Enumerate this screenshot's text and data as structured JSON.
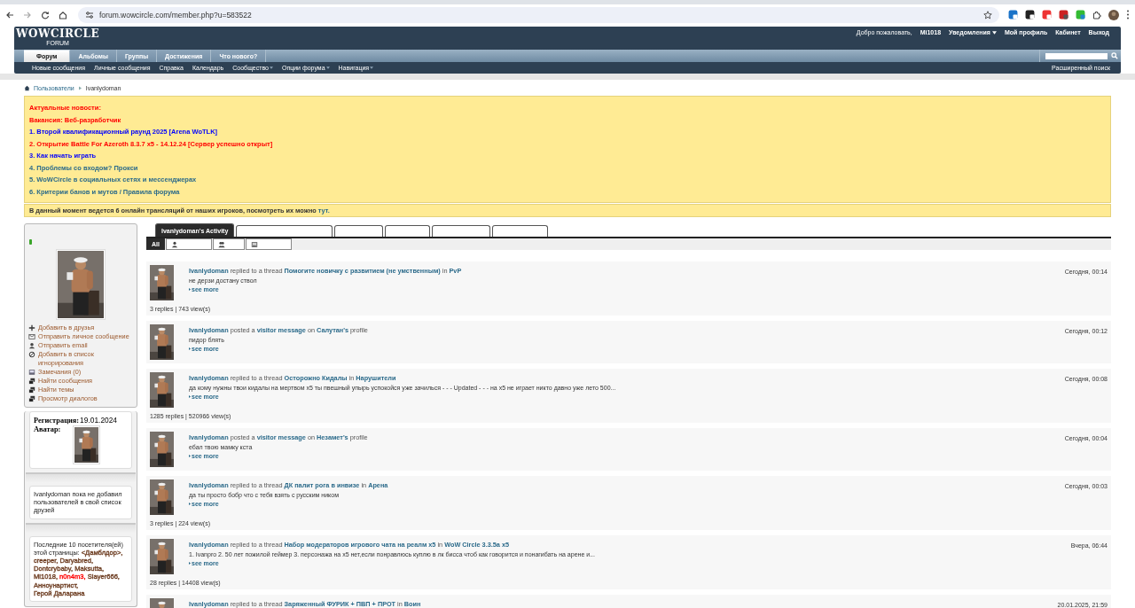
{
  "browser": {
    "url": "forum.wowcircle.com/member.php?u=583522"
  },
  "header": {
    "logo": "WOWCIRCLE",
    "logo_sub": "FORUM",
    "user_links": [
      {
        "label": "Добро пожаловать,",
        "kind": "text"
      },
      {
        "label": "Mi1018",
        "kind": "user"
      },
      {
        "label": "Уведомления",
        "kind": "menu"
      },
      {
        "label": "Мой профиль",
        "kind": "link"
      },
      {
        "label": "Кабинет",
        "kind": "link"
      },
      {
        "label": "Выход",
        "kind": "link"
      }
    ],
    "nav_tabs": [
      {
        "label": "Форум",
        "selected": true
      },
      {
        "label": "Альбомы",
        "selected": false
      },
      {
        "label": "Группы",
        "selected": false
      },
      {
        "label": "Достижения",
        "selected": false
      },
      {
        "label": "Что нового?",
        "selected": false
      }
    ],
    "subnav": [
      {
        "label": "Новые сообщения",
        "dropdown": false
      },
      {
        "label": "Личные сообщения",
        "dropdown": false
      },
      {
        "label": "Справка",
        "dropdown": false
      },
      {
        "label": "Календарь",
        "dropdown": false
      },
      {
        "label": "Сообщество",
        "dropdown": true
      },
      {
        "label": "Опции форума",
        "dropdown": true
      },
      {
        "label": "Навигация",
        "dropdown": true
      }
    ],
    "advanced_search": "Расширенный поиск"
  },
  "breadcrumb": [
    "Пользователи",
    "Ivanlydoman"
  ],
  "news": {
    "items": [
      {
        "text": "Актуальные новости:",
        "color": "#ff0000"
      },
      {
        "text": "Вакансия: Веб-разработчик",
        "color": "#ff0000"
      },
      {
        "text": "1. Второй квалификационный раунд 2025 [Arena WoTLK]",
        "color": "#0000ff"
      },
      {
        "text": "2. Открытие Battle For Azeroth 8.3.7 x5 - 14.12.24 [Сервер успешно открыт]",
        "color": "#ff0000"
      },
      {
        "text": "3. Как начать играть",
        "color": "#0000ff"
      },
      {
        "text": "4. Проблемы со входом? Прокси",
        "color": "#2b6a8a"
      },
      {
        "text": "5. WoWCircle в социальных сетях и мессенджерах",
        "color": "#2b6a8a"
      },
      {
        "text": "6. Критерии банов и мутов / Правила форума",
        "color": "#2b6a8a"
      }
    ]
  },
  "live_bar": {
    "text": "В данный момент ведется 6 онлайн трансляций от наших игроков, посмотреть их можно",
    "link": "тут."
  },
  "sidebar": {
    "online": true,
    "links": [
      "Добавить в друзья",
      "Отправить личное сообщение",
      "Отправить email",
      "Добавить в список игнорирования",
      "Замечания (0)",
      "Найти сообщения",
      "Найти темы",
      "Просмотр диалогов"
    ],
    "registration": {
      "label": "Регистрация:",
      "value": "19.01.2024"
    },
    "avatar_label": "Аватар:",
    "friends_text": "Ivanlydoman пока не добавил пользователей в свой список друзей",
    "visitors_intro": "Последние 10 посетителя(ей) этой страницы:",
    "visitors": [
      {
        "name": "<Дамблдор>,",
        "color": "#6b3a1e"
      },
      {
        "name": "creeper,",
        "color": "#6b3a1e"
      },
      {
        "name": "Daryabred,",
        "color": "#6b3a1e"
      },
      {
        "name": "Dontcrybaby,",
        "color": "#6b3a1e"
      },
      {
        "name": "Maksutta,",
        "color": "#6b3a1e"
      },
      {
        "name": "Mi1018,",
        "color": "#6b3a1e"
      },
      {
        "name": "n0n4m3,",
        "color": "#ff0000"
      },
      {
        "name": "Slayer666,",
        "color": "#6b3a1e"
      },
      {
        "name": "Анноунартист,",
        "color": "#6b3a1e"
      },
      {
        "name": "Герой Даларана",
        "color": "#6b3a1e"
      }
    ]
  },
  "activity": {
    "tabs": [
      {
        "label": "Ivanlydoman's Activity",
        "selected": true
      },
      {
        "selected": false
      },
      {
        "selected": false
      },
      {
        "selected": false
      },
      {
        "selected": false
      },
      {
        "selected": false
      }
    ],
    "subtabs": [
      {
        "label": "All",
        "selected": true
      },
      {
        "selected": false
      },
      {
        "selected": false
      },
      {
        "selected": false
      }
    ],
    "items": [
      {
        "headline": [
          {
            "text": "Ivanlydoman",
            "link": true
          },
          {
            "text": "replied to a thread",
            "link": false
          },
          {
            "text": "Помогите новичку с развитием (не умственным)",
            "link": true
          },
          {
            "text": "in",
            "link": false
          },
          {
            "text": "PvP",
            "link": true
          }
        ],
        "excerpt": "не дерзи достану ствол",
        "more": "see more",
        "stats": "3 replies | 743 view(s)",
        "time": "Сегодня, 00:14"
      },
      {
        "headline": [
          {
            "text": "Ivanlydoman",
            "link": true
          },
          {
            "text": "posted a",
            "link": false
          },
          {
            "text": "visitor message",
            "link": true
          },
          {
            "text": "on",
            "link": false
          },
          {
            "text": "Салутан's",
            "link": true
          },
          {
            "text": "profile",
            "link": false
          }
        ],
        "excerpt": "пидор блять",
        "more": "see more",
        "time": "Сегодня, 00:12"
      },
      {
        "headline": [
          {
            "text": "Ivanlydoman",
            "link": true
          },
          {
            "text": "replied to a thread",
            "link": false
          },
          {
            "text": "Осторожно Кидалы",
            "link": true
          },
          {
            "text": "in",
            "link": false
          },
          {
            "text": "Нарушители",
            "link": true
          }
        ],
        "excerpt": "да кому нужны твои кидалы на мертвом х5 ты пвешный упырь успокойся уже зачилься - - - Updated - - - на х5 не играет никто давно уже лето 500...",
        "more": "see more",
        "stats": "1285 replies | 520966 view(s)",
        "time": "Сегодня, 00:08"
      },
      {
        "headline": [
          {
            "text": "Ivanlydoman",
            "link": true
          },
          {
            "text": "posted a",
            "link": false
          },
          {
            "text": "visitor message",
            "link": true
          },
          {
            "text": "on",
            "link": false
          },
          {
            "text": "Незамет's",
            "link": true
          },
          {
            "text": "profile",
            "link": false
          }
        ],
        "excerpt": "ебал твою мамку кста",
        "more": "see more",
        "time": "Сегодня, 00:04"
      },
      {
        "headline": [
          {
            "text": "Ivanlydoman",
            "link": true
          },
          {
            "text": "replied to a thread",
            "link": false
          },
          {
            "text": "ДК палит рога в инвизе",
            "link": true
          },
          {
            "text": "in",
            "link": false
          },
          {
            "text": "Арена",
            "link": true
          }
        ],
        "excerpt": "да ты просто бобр что с тебя взять с русским ником",
        "more": "see more",
        "stats": "3 replies | 224 view(s)",
        "time": "Сегодня, 00:03"
      },
      {
        "headline": [
          {
            "text": "Ivanlydoman",
            "link": true
          },
          {
            "text": "replied to a thread",
            "link": false
          },
          {
            "text": "Набор модераторов игрового чата на реалм x5",
            "link": true
          },
          {
            "text": "in",
            "link": false
          },
          {
            "text": "WoW Circle 3.3.5a x5",
            "link": true
          }
        ],
        "excerpt": "1. Ivanpro 2. 50 лет пожилой геймер 3. персонажа на х5 нет,если понравлюсь куплю в лк бисса чтоб как говорится и понагибать на арене и...",
        "more": "see more",
        "stats": "28 replies | 14408 view(s)",
        "time": "Вчера, 06:44"
      },
      {
        "headline": [
          {
            "text": "Ivanlydoman",
            "link": true
          },
          {
            "text": "replied to a thread",
            "link": false
          },
          {
            "text": "Заряженный ФУРИК + ПВП + ПРОТ",
            "link": true
          },
          {
            "text": "in",
            "link": false
          },
          {
            "text": "Воин",
            "link": true
          }
        ],
        "time": "20.01.2025, 21:59"
      }
    ]
  }
}
